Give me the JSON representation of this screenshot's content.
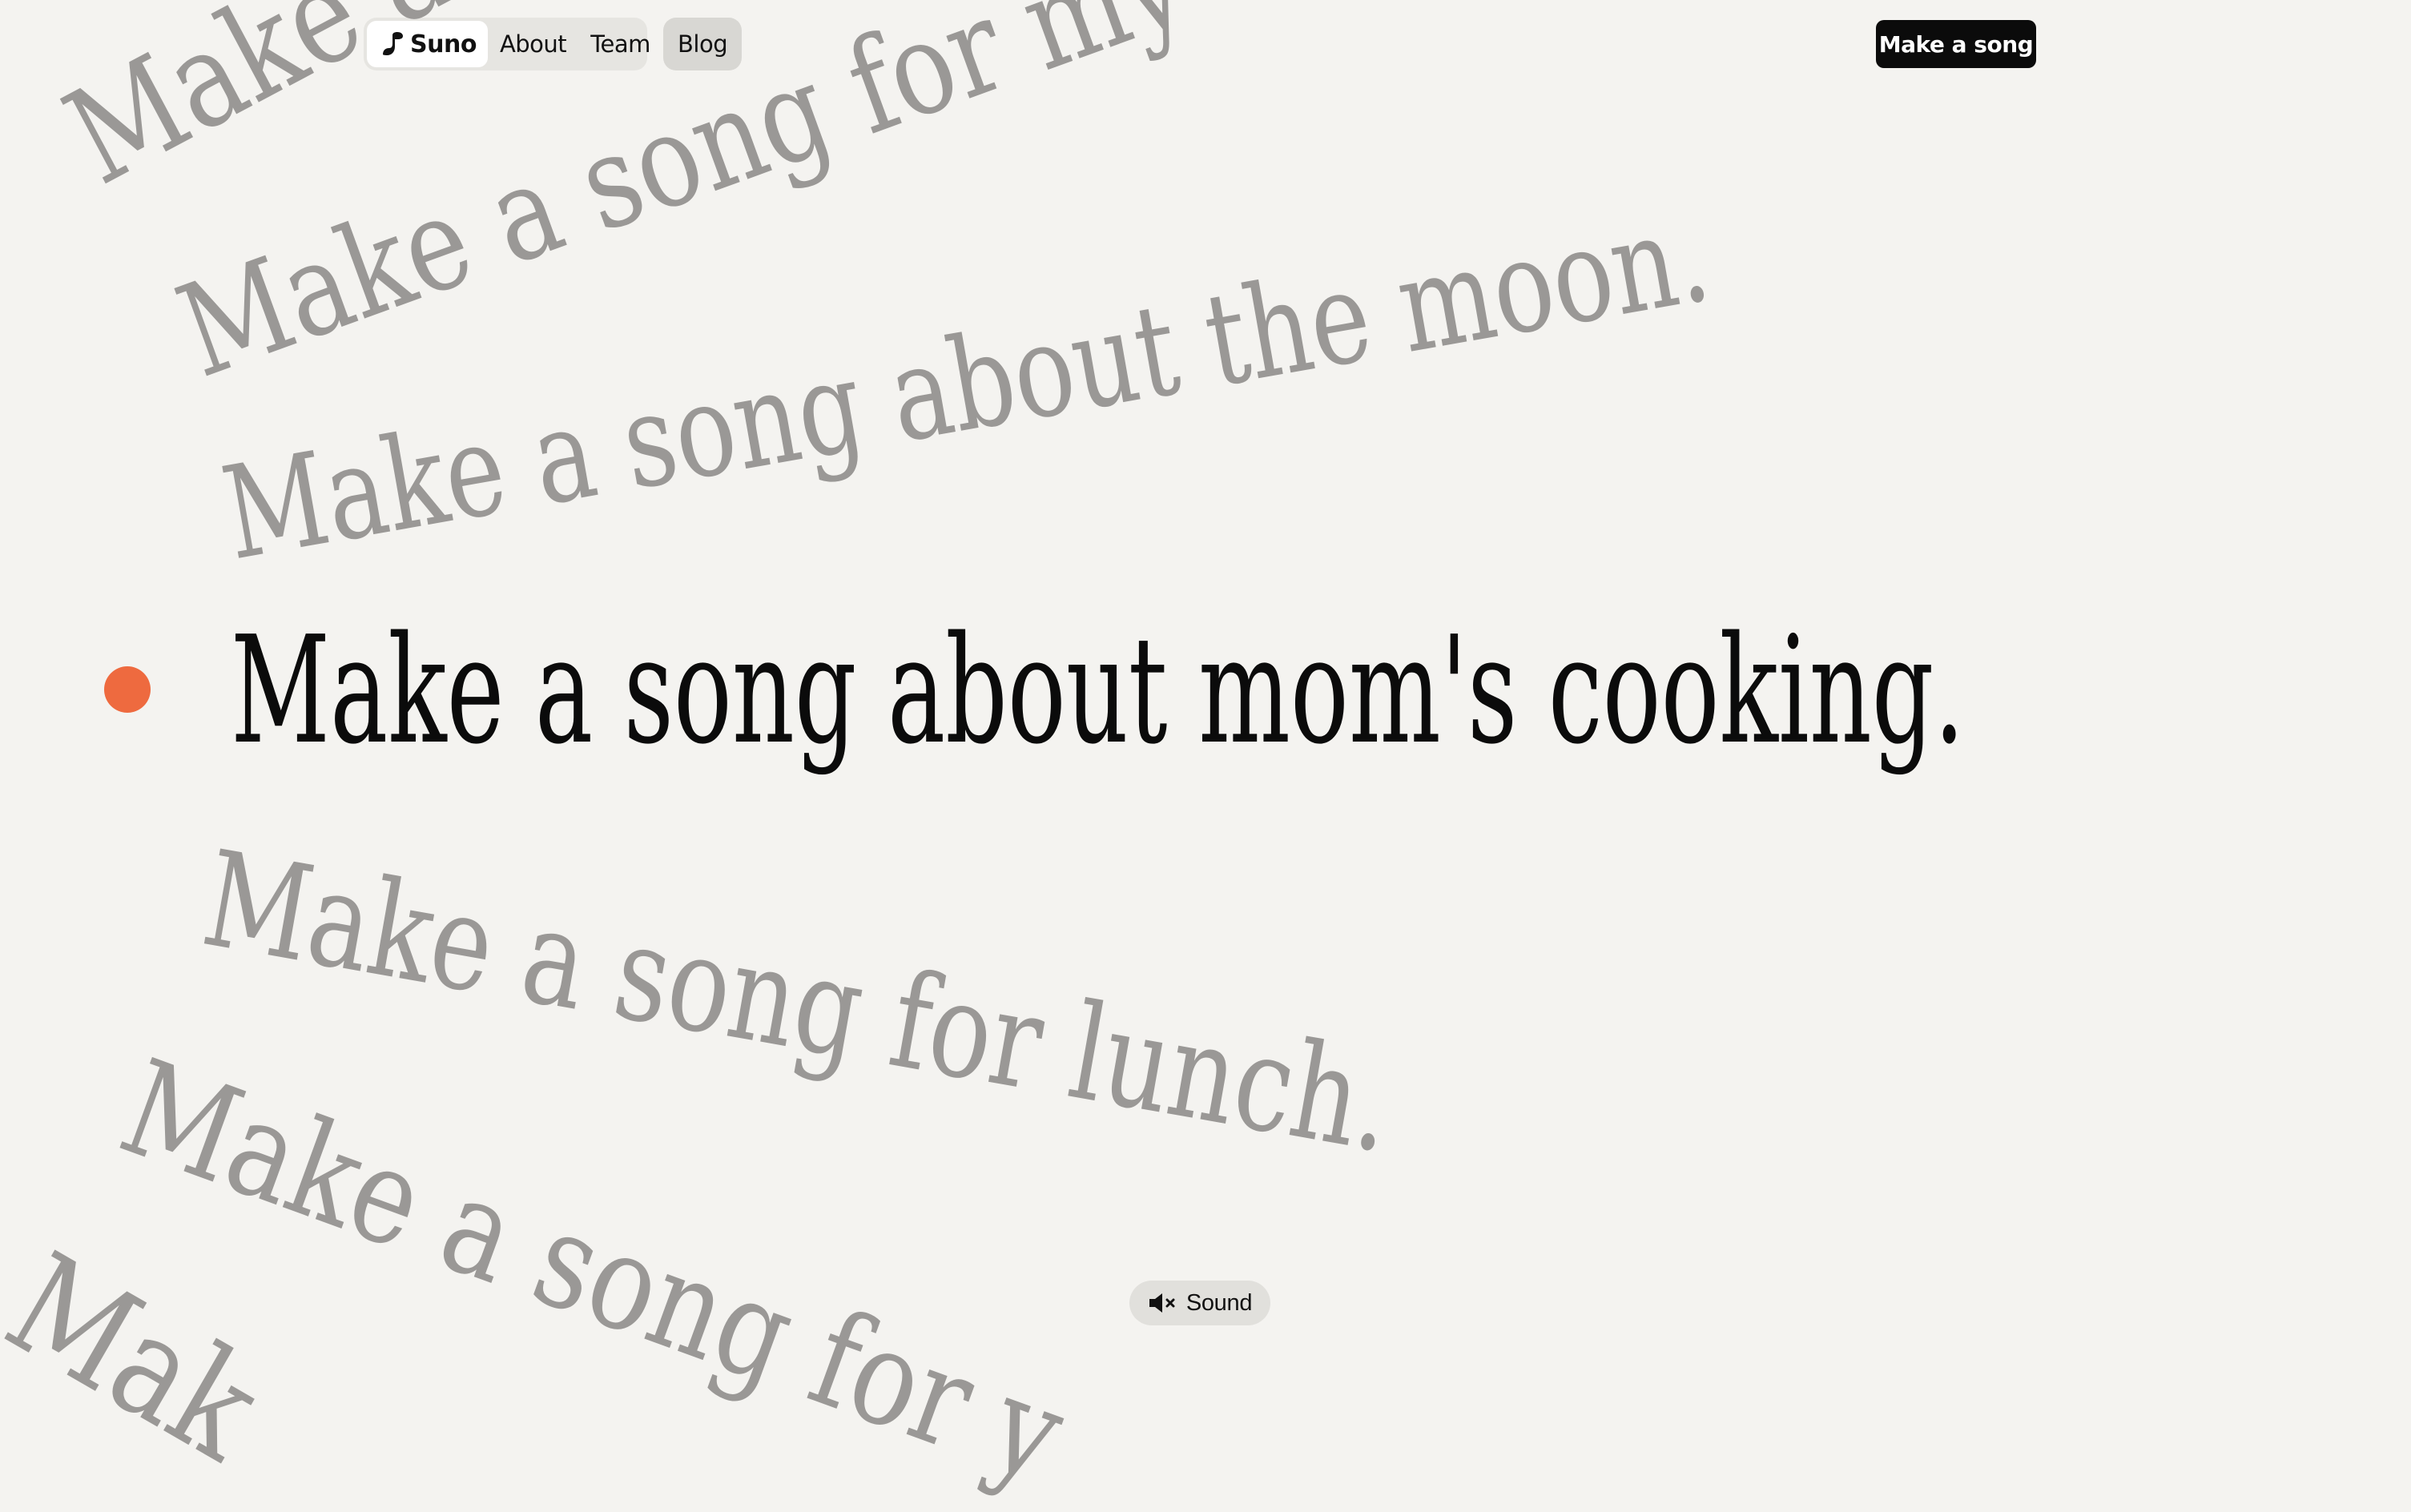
{
  "nav": {
    "brand": "Suno",
    "links": [
      "About",
      "Team"
    ],
    "blog": "Blog"
  },
  "cta_label": "Make a song",
  "prompts": {
    "line_1": "Make a song for my",
    "line_2": "Make a song for my",
    "line_3": "Make a song about the moon.",
    "active": "Make a song about mom's cooking.",
    "line_5": "Make a song for lunch.",
    "line_6": "Make a song for y",
    "line_7": "Mak"
  },
  "sound": {
    "label": "Sound",
    "icon": "speaker-muted-icon"
  },
  "colors": {
    "background": "#f4f3f0",
    "accent_dot": "#ee6a3f",
    "inactive_text": "#9a9896",
    "active_text": "#0b0b0b",
    "cta_background": "#0b0b0b"
  }
}
